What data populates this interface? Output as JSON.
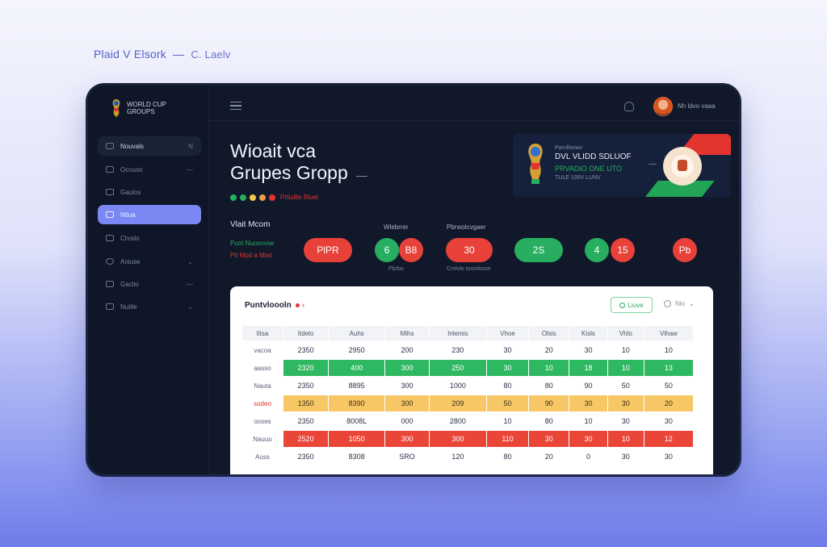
{
  "caption": {
    "main": "Plaid V Elsork",
    "sep": "—",
    "sub": "C. Laelv"
  },
  "app": {
    "brand": "WORLD CUP GROUPS",
    "user_name": "Nh ldvo vaaa"
  },
  "sidebar": {
    "items": [
      {
        "label": "Nouvals",
        "trail": "N"
      },
      {
        "label": "Occuoo",
        "trail": "—"
      },
      {
        "label": "Gaulos",
        "trail": ""
      },
      {
        "label": "Ntlua",
        "trail": ""
      },
      {
        "label": "Chodo",
        "trail": ""
      },
      {
        "label": "Aniuse",
        "trail": "⌄"
      },
      {
        "label": "Gaclio",
        "trail": "—"
      },
      {
        "label": "Nutile",
        "trail": "⌄"
      }
    ]
  },
  "header": {
    "title_line1": "Wioait vca",
    "title_line2": "Grupes Gropp",
    "title_dash": "—",
    "status_dots": [
      "#27ae60",
      "#27ae60",
      "#f2c94c",
      "#f2994a",
      "#e3342f"
    ],
    "status_label": "Prtiullte Bluel"
  },
  "hero": {
    "line1": "Parnlloowv",
    "line2": "DVL VLIDD SDLUOF",
    "line3": "PRVADIO ONE UTO",
    "line4": "TULE 100V LUNV",
    "dash": "—"
  },
  "results": {
    "label": "Vlait Mcom",
    "mini1": "Puot Nuosnvse",
    "mini2": "Ptl Mpd a Mtat",
    "col_head1": "Wlebrrer",
    "col_head2": "Pbrwolcvgaer",
    "col_foot1": "Pbrbo",
    "col_foot2": "Crnlvlo toomloom",
    "pill1": "PlPR",
    "circle1": "6",
    "circle2": "B8",
    "pill2": "30",
    "pill3": "2S",
    "circle3": "4",
    "circle4": "15",
    "circle5": "Pb"
  },
  "card": {
    "title": "Puntvloooln",
    "chev": "›",
    "button_label": "Liuve",
    "filter_label": "Nlo",
    "columns": [
      "Iitsa",
      "Itdelo",
      "Auhs",
      "Mihs",
      "Inlemis",
      "Vhoe",
      "Olsis",
      "Kisls",
      "Vhlo",
      "Vlhaw"
    ],
    "rows": [
      {
        "label": "vacoa",
        "style": "w",
        "cells": [
          "2350",
          "2950",
          "200",
          "230",
          "30",
          "20",
          "30",
          "10",
          "10"
        ]
      },
      {
        "label": "aasso",
        "style": "g",
        "cells": [
          "2320",
          "400",
          "300",
          "250",
          "30",
          "10",
          "18",
          "10",
          "13"
        ]
      },
      {
        "label": "Nauta",
        "style": "w",
        "cells": [
          "2350",
          "8895",
          "300",
          "1000",
          "80",
          "80",
          "90",
          "50",
          "50"
        ]
      },
      {
        "label": "sodeo",
        "style": "y",
        "cells": [
          "1350",
          "8390",
          "300",
          "209",
          "50",
          "90",
          "30",
          "30",
          "20"
        ]
      },
      {
        "label": "ooses",
        "style": "w",
        "cells": [
          "2350",
          "8008L",
          "000",
          "2800",
          "10",
          "80",
          "10",
          "30",
          "30"
        ]
      },
      {
        "label": "Nauuo",
        "style": "r",
        "cells": [
          "2520",
          "1050",
          "300",
          "300",
          "110",
          "30",
          "30",
          "10",
          "12"
        ]
      },
      {
        "label": "Auss",
        "style": "w",
        "cells": [
          "2350",
          "8308",
          "SRO",
          "120",
          "80",
          "20",
          "0",
          "30",
          "30"
        ]
      }
    ]
  }
}
